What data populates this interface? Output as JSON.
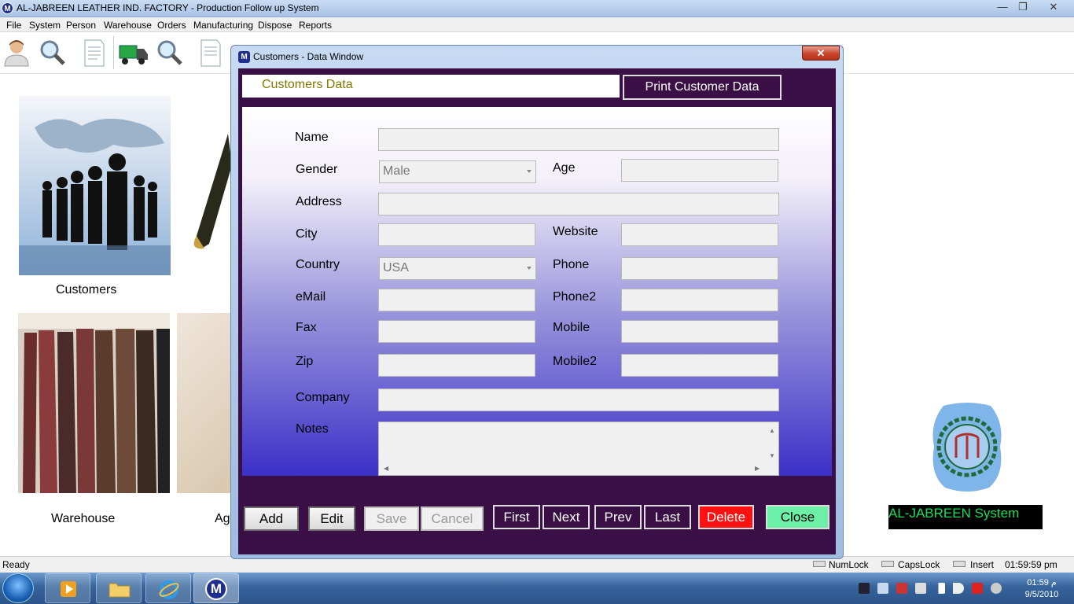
{
  "window": {
    "title": "AL-JABREEN LEATHER IND. FACTORY - Production Follow up System",
    "app_icon": "M"
  },
  "menu": [
    "File",
    "System",
    "Person",
    "Warehouse",
    "Orders",
    "Manufacturing",
    "Dispose",
    "Reports"
  ],
  "desktop": {
    "tiles": {
      "customers": "Customers",
      "warehouse": "Warehouse",
      "partial": "Ag"
    },
    "system_label": "AL-JABREEN System"
  },
  "dialog": {
    "title": "Customers - Data Window",
    "close_glyph": "✕",
    "header_title": "Customers Data",
    "print_button": "Print Customer Data",
    "labels": {
      "name": "Name",
      "gender": "Gender",
      "age": "Age",
      "address": "Address",
      "city": "City",
      "website": "Website",
      "country": "Country",
      "phone": "Phone",
      "email": "eMail",
      "phone2": "Phone2",
      "fax": "Fax",
      "mobile": "Mobile",
      "zip": "Zip",
      "mobile2": "Mobile2",
      "company": "Company",
      "notes": "Notes"
    },
    "values": {
      "name": "",
      "gender": "Male",
      "age": "",
      "address": "",
      "city": "",
      "website": "",
      "country": "USA",
      "phone": "",
      "email": "",
      "phone2": "",
      "fax": "",
      "mobile": "",
      "zip": "",
      "mobile2": "",
      "company": "",
      "notes": ""
    },
    "buttons": {
      "add": "Add",
      "edit": "Edit",
      "save": "Save",
      "cancel": "Cancel",
      "first": "First",
      "next": "Next",
      "prev": "Prev",
      "last": "Last",
      "delete": "Delete",
      "close": "Close"
    }
  },
  "statusbar": {
    "ready": "Ready",
    "numlock": "NumLock",
    "capslock": "CapsLock",
    "insert": "Insert",
    "time": "01:59:59 pm"
  },
  "taskbar": {
    "clock_time": "01:59 م",
    "clock_date": "9/5/2010",
    "active_app_icon": "M"
  },
  "colors": {
    "dialog_client": "#3a0f45",
    "delete_button": "#ff1111",
    "close_button": "#6cf0a8",
    "header_title_text": "#807800",
    "system_label_text": "#12e05a"
  }
}
